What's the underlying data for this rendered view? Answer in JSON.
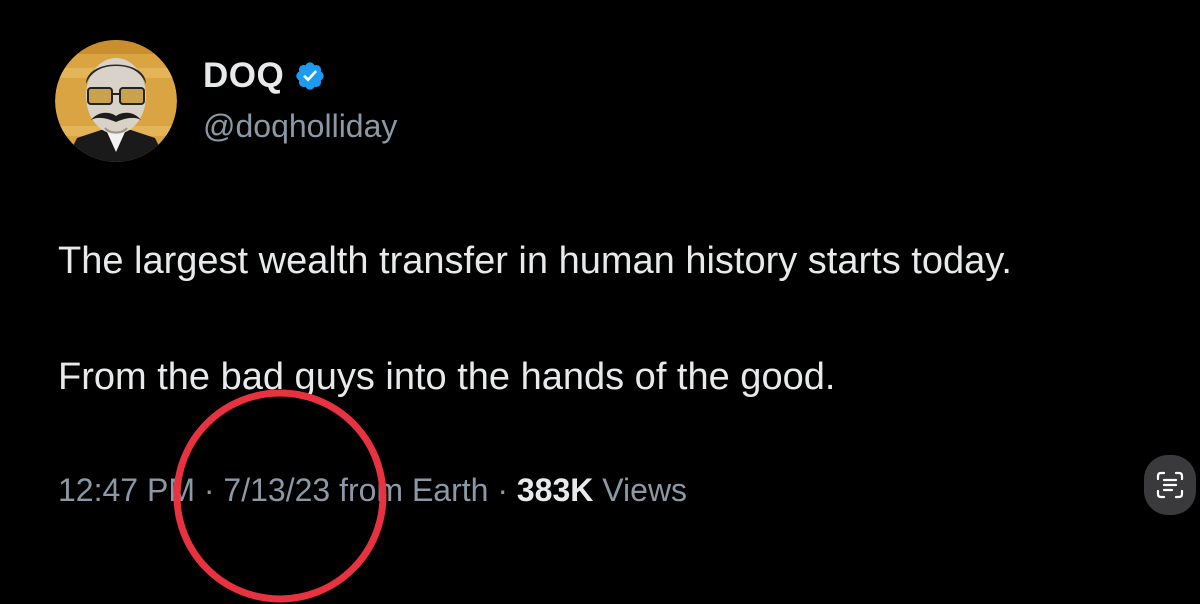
{
  "tweet": {
    "author": {
      "display_name": "DOQ",
      "handle": "@doqholliday",
      "verified": true,
      "avatar_icon": "profile-avatar"
    },
    "text_lines": [
      "The largest wealth transfer in human history starts today.",
      "From the bad guys into the hands of the good."
    ],
    "meta": {
      "time": "12:47 PM",
      "separator": "·",
      "date": "7/13/23",
      "location": "from Earth",
      "views_count": "383K",
      "views_label": "Views"
    }
  },
  "overlay": {
    "annotation_circle_color": "#e8323f",
    "scan_button_icon": "live-text-scan-icon"
  },
  "colors": {
    "background": "#000000",
    "text_primary": "#e7e9ea",
    "text_secondary": "#8b98a5",
    "verified_blue": "#1d9bf0"
  }
}
